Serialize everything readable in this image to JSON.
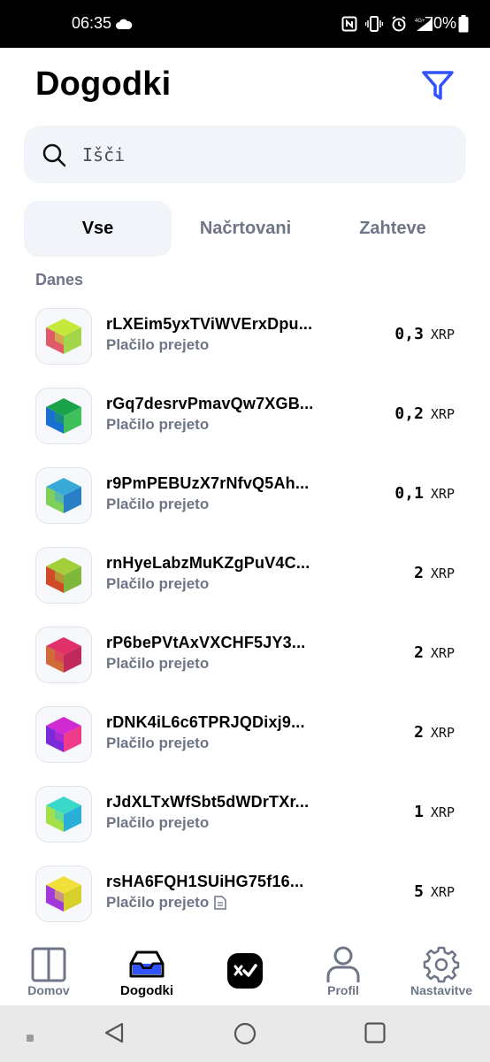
{
  "status_bar": {
    "time": "06:35",
    "battery_pct": "70%"
  },
  "header": {
    "title": "Dogodki"
  },
  "search": {
    "placeholder": "Išči"
  },
  "tabs": [
    {
      "label": "Vse",
      "active": true
    },
    {
      "label": "Načrtovani",
      "active": false
    },
    {
      "label": "Zahteve",
      "active": false
    }
  ],
  "section": {
    "label": "Danes"
  },
  "events": [
    {
      "address": "rLXEim5yxTViWVErxDpu...",
      "status": "Plačilo prejeto",
      "amount": "0,3",
      "currency": "XRP"
    },
    {
      "address": "rGq7desrvPmavQw7XGB...",
      "status": "Plačilo prejeto",
      "amount": "0,2",
      "currency": "XRP"
    },
    {
      "address": "r9PmPEBUzX7rNfvQ5Ah...",
      "status": "Plačilo prejeto",
      "amount": "0,1",
      "currency": "XRP"
    },
    {
      "address": "rnHyeLabzMuKZgPuV4C...",
      "status": "Plačilo prejeto",
      "amount": "2",
      "currency": "XRP"
    },
    {
      "address": "rP6bePVtAxVXCHF5JY3...",
      "status": "Plačilo prejeto",
      "amount": "2",
      "currency": "XRP"
    },
    {
      "address": "rDNK4iL6c6TPRJQDixj9...",
      "status": "Plačilo prejeto",
      "amount": "2",
      "currency": "XRP"
    },
    {
      "address": "rJdXLTxWfSbt5dWDrTXr...",
      "status": "Plačilo prejeto",
      "amount": "1",
      "currency": "XRP"
    },
    {
      "address": "rsHA6FQH1SUiHG75f16...",
      "status": "Plačilo prejeto",
      "amount": "5",
      "currency": "XRP"
    }
  ],
  "avatar_colors": [
    [
      "#c6e83a",
      "#e05a6a",
      "#a3d64a"
    ],
    [
      "#1aa34a",
      "#1a6fd1",
      "#3ec15a"
    ],
    [
      "#3aa9d8",
      "#7fd05a",
      "#2a7fc8"
    ],
    [
      "#a3cf3a",
      "#d04a2a",
      "#7fb83a"
    ],
    [
      "#e0306a",
      "#d06a3a",
      "#c02a5a"
    ],
    [
      "#d02ad0",
      "#7a2ad8",
      "#f03a8a"
    ],
    [
      "#3ad8c8",
      "#a3e04a",
      "#2ab0d8"
    ],
    [
      "#f0e03a",
      "#a03ad8",
      "#d8d02a"
    ]
  ],
  "bottom_nav": [
    {
      "label": "Domov",
      "icon": "wallet-icon",
      "active": false
    },
    {
      "label": "Dogodki",
      "icon": "inbox-icon",
      "active": true
    },
    {
      "label": "",
      "icon": "xumm-logo-icon",
      "active": false
    },
    {
      "label": "Profil",
      "icon": "person-icon",
      "active": false
    },
    {
      "label": "Nastavitve",
      "icon": "gear-icon",
      "active": false
    }
  ],
  "colors": {
    "accent": "#3052ff",
    "muted": "#6e7587",
    "surface": "#f1f4f8"
  }
}
